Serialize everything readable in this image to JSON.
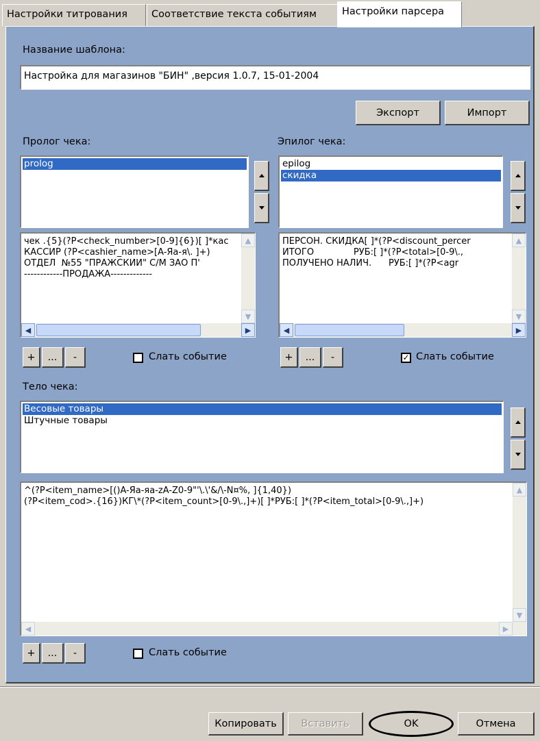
{
  "tabs": [
    {
      "label": "Настройки титрования"
    },
    {
      "label": "Соответствие текста событиям"
    },
    {
      "label": "Настройки парсера"
    }
  ],
  "template": {
    "label": "Название шаблона:",
    "value": "Настройка для магазинов \"БИН\" ,версия 1.0.7, 15-01-2004"
  },
  "buttons": {
    "export": "Экспорт",
    "import": "Импорт"
  },
  "prolog": {
    "label": "Пролог чека:",
    "items": [
      "prolog"
    ],
    "selected": 0,
    "text_lines": [
      "чек .{5}(?P<check_number>[0-9]{6})[ ]*кас",
      "КАССИР (?P<cashier_name>[A-Яa-я\\. ]+)",
      "ОТДЕЛ  №55 \"ПРАЖСКИЙ\" С/М ЗАО П'",
      "------------ПРОДАЖА-------------"
    ],
    "send_event": "Слать событие",
    "send_event_checked": false
  },
  "epilog": {
    "label": "Эпилог чека:",
    "items": [
      "epilog",
      "скидка"
    ],
    "selected": 1,
    "text_lines": [
      "ПЕРСОН. СКИДКА[ ]*(?P<discount_percer",
      "ИТОГО              РУБ:[ ]*(?P<total>[0-9\\.,",
      "ПОЛУЧЕНО НАЛИЧ.      РУБ:[ ]*(?P<agr"
    ],
    "send_event": "Слать событие",
    "send_event_checked": true
  },
  "body": {
    "label": "Тело чека:",
    "items": [
      "Весовые товары",
      "Штучные товары"
    ],
    "selected": 0,
    "text_lines": [
      "^(?P<item_name>[()A-Яа-яa-zA-Z0-9\"'\\.\\'&/\\-N¤%, ]{1,40})",
      "(?P<item_cod>.{16})КГ\\*(?P<item_count>[0-9\\.,]+)[ ]*РУБ:[ ]*(?P<item_total>[0-9\\.,]+)"
    ],
    "send_event": "Слать событие",
    "send_event_checked": false
  },
  "list_buttons": {
    "add": "+",
    "edit": "...",
    "remove": "-"
  },
  "footer": {
    "copy": "Копировать",
    "paste": "Вставить",
    "ok": "OK",
    "cancel": "Отмена"
  },
  "icons": {
    "scroll_up": "scroll-up-arrow",
    "scroll_down": "scroll-down-arrow",
    "scroll_left": "scroll-left-arrow",
    "scroll_right": "scroll-right-arrow"
  },
  "colors": {
    "panel": "#8ca4c8",
    "selection": "#316ac5",
    "dialog": "#d4d0c8"
  }
}
